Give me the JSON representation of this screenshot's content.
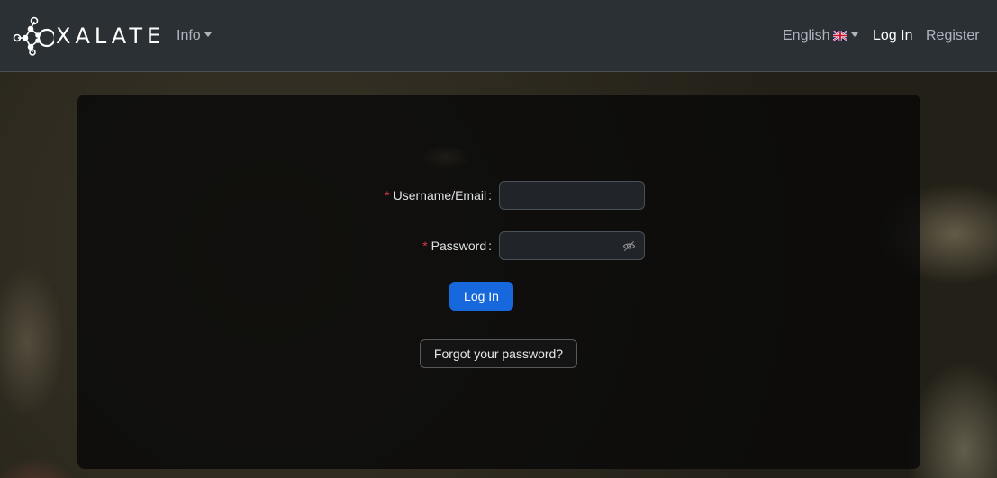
{
  "brand": {
    "name": "XALATE"
  },
  "nav": {
    "info_label": "Info",
    "language_label": "English",
    "login_label": "Log In",
    "register_label": "Register"
  },
  "form": {
    "username_label": "Username/Email",
    "username_value": "",
    "password_label": "Password",
    "password_value": "",
    "required_marker": "*",
    "colon": ":",
    "submit_label": "Log In",
    "forgot_label": "Forgot your password?"
  },
  "colors": {
    "navbar": "#2b3035",
    "primary": "#1668dc",
    "required": "#dc3545"
  },
  "icons": [
    "oxalate-logo-icon",
    "chevron-down-icon",
    "uk-flag-icon",
    "eye-invisible-icon"
  ]
}
